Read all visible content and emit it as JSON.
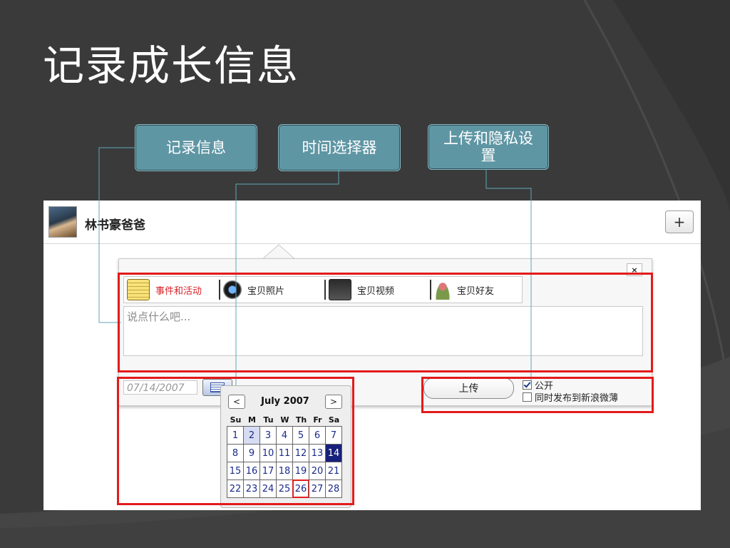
{
  "slide": {
    "title": "记录成长信息",
    "callouts": [
      "记录信息",
      "时间选择器",
      "上传和隐私设置"
    ]
  },
  "panel": {
    "user_name": "林书豪爸爸",
    "add_button": "+",
    "close_button": "×",
    "tabs": [
      {
        "label": "事件和活动",
        "icon": "notepad-icon",
        "active": true
      },
      {
        "label": "宝贝照片",
        "icon": "camera-icon",
        "active": false
      },
      {
        "label": "宝贝视频",
        "icon": "video-icon",
        "active": false
      },
      {
        "label": "宝贝好友",
        "icon": "friend-icon",
        "active": false
      }
    ],
    "textarea_placeholder": "说点什么吧...",
    "date_value": "07/14/2007",
    "upload_button": "上传",
    "options": [
      {
        "label": "公开",
        "checked": true
      },
      {
        "label": "同时发布到新浪微薄",
        "checked": false
      }
    ]
  },
  "calendar": {
    "prev": "<",
    "next": ">",
    "month_title": "July 2007",
    "weekdays": [
      "Su",
      "M",
      "Tu",
      "W",
      "Th",
      "Fr",
      "Sa"
    ],
    "weeks": [
      [
        "1",
        "2",
        "3",
        "4",
        "5",
        "6",
        "7"
      ],
      [
        "8",
        "9",
        "10",
        "11",
        "12",
        "13",
        "14"
      ],
      [
        "15",
        "16",
        "17",
        "18",
        "19",
        "20",
        "21"
      ],
      [
        "22",
        "23",
        "24",
        "25",
        "26",
        "27",
        "28"
      ]
    ],
    "selected_day": "14",
    "highlighted_day": "2",
    "today_day": "26"
  },
  "colors": {
    "background": "#3a3a3a",
    "callout": "#5f96a4",
    "highlight_box": "#e31b1b",
    "selected_day": "#17207a",
    "active_tab_text": "#d9232a"
  }
}
